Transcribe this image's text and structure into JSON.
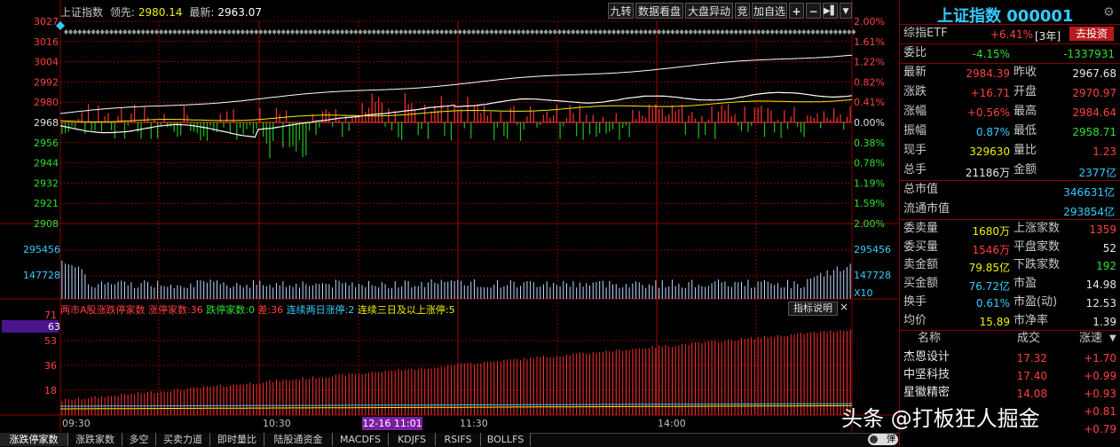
{
  "header": {
    "index_name": "上证指数",
    "lead_label": "领先:",
    "lead_value": "2980.14",
    "last_label": "最新:",
    "last_value": "2963.07"
  },
  "toolbar": {
    "buttons": [
      "九转",
      "数据看盘",
      "大盘异动",
      "竞",
      "加自选"
    ],
    "icon_buttons": [
      "plus-icon",
      "minus-icon",
      "play-icon",
      "dropdown-icon"
    ]
  },
  "price_axis_left": [
    "3027",
    "3016",
    "3004",
    "2992",
    "2980",
    "2968",
    "2956",
    "2944",
    "2932",
    "2921",
    "2908"
  ],
  "price_axis_right": [
    "2.00%",
    "1.61%",
    "1.22%",
    "0.82%",
    "0.41%",
    "0.00%",
    "0.38%",
    "0.78%",
    "1.19%",
    "1.59%",
    "2.00%"
  ],
  "volume_axis_left": [
    "295456",
    "147728"
  ],
  "volume_axis_right": [
    "295456",
    "147728",
    "X10"
  ],
  "sub_chart": {
    "title": "两市A股涨跌停家数",
    "limit_up_label": "涨停家数:",
    "limit_up_value": "36",
    "limit_down_label": "跌停家数:",
    "limit_down_value": "0",
    "diff_label": "差:",
    "diff_value": "36",
    "two_day_label": "连续两日涨停:",
    "two_day_value": "2",
    "three_day_label": "连续三日及以上涨停:",
    "three_day_value": "5",
    "indicator_button": "指标说明",
    "close": "×",
    "axis": [
      "71",
      "63",
      "53",
      "36",
      "18"
    ]
  },
  "time_axis": {
    "labels": [
      "09:30",
      "10:30",
      "11:30",
      "14:00"
    ],
    "flag": "12-16 11:01"
  },
  "bottom_tabs": [
    "涨跌停家数",
    "涨跌家数",
    "多空",
    "买卖力道",
    "即时量比",
    "陆股通资金",
    "MACDFS",
    "KDJFS",
    "RSIFS",
    "BOLLFS"
  ],
  "toggle_label": "弹",
  "watermark": "头条 @打板狂人掘金",
  "panel": {
    "title": "上证指数 000001",
    "etf_name": "综指ETF",
    "etf_change": "+6.41%",
    "etf_period": "[3年]",
    "etf_button": "去投资",
    "ratio_label": "委比",
    "ratio_pct": "-4.15%",
    "ratio_value": "-1337931",
    "quotes": [
      {
        "l1": "最新",
        "v1": "2984.39",
        "c1": "red",
        "l2": "昨收",
        "v2": "2967.68",
        "c2": "white"
      },
      {
        "l1": "涨跌",
        "v1": "+16.71",
        "c1": "red",
        "l2": "开盘",
        "v2": "2970.97",
        "c2": "red"
      },
      {
        "l1": "涨幅",
        "v1": "+0.56%",
        "c1": "red",
        "l2": "最高",
        "v2": "2984.64",
        "c2": "red"
      },
      {
        "l1": "振幅",
        "v1": "0.87%",
        "c1": "cyan",
        "l2": "最低",
        "v2": "2958.71",
        "c2": "green"
      },
      {
        "l1": "现手",
        "v1": "329630",
        "c1": "yellow",
        "l2": "量比",
        "v2": "1.23",
        "c2": "red"
      },
      {
        "l1": "总手",
        "v1": "21186万",
        "c1": "white",
        "l2": "金额",
        "v2": "2377亿",
        "c2": "cyan"
      }
    ],
    "mcap": [
      {
        "l": "总市值",
        "v": "346631亿"
      },
      {
        "l": "流通市值",
        "v": "293854亿"
      }
    ],
    "stats": [
      {
        "l1": "委卖量",
        "v1": "1680万",
        "c1": "yellow",
        "l2": "上涨家数",
        "v2": "1359",
        "c2": "red"
      },
      {
        "l1": "委买量",
        "v1": "1546万",
        "c1": "red",
        "l2": "平盘家数",
        "v2": "52",
        "c2": "white"
      },
      {
        "l1": "卖金额",
        "v1": "79.85亿",
        "c1": "yellow",
        "l2": "下跌家数",
        "v2": "192",
        "c2": "green"
      },
      {
        "l1": "买金额",
        "v1": "76.72亿",
        "c1": "cyan",
        "l2": "市盈",
        "v2": "14.98",
        "c2": "white"
      },
      {
        "l1": "换手",
        "v1": "0.61%",
        "c1": "cyan",
        "l2": "市盈(动)",
        "v2": "12.53",
        "c2": "white"
      },
      {
        "l1": "均价",
        "v1": "15.89",
        "c1": "yellow",
        "l2": "市净率",
        "v2": "1.39",
        "c2": "white"
      }
    ],
    "table_headers": [
      "名称",
      "成交",
      "涨速"
    ],
    "table_rows": [
      {
        "name": "杰恩设计",
        "price": "17.32",
        "speed": "+1.70"
      },
      {
        "name": "中坚科技",
        "price": "17.40",
        "speed": "+0.99"
      },
      {
        "name": "星徽精密",
        "price": "14.08",
        "speed": "+0.93"
      },
      {
        "name": "",
        "price": "",
        "speed": "+0.81"
      },
      {
        "name": "",
        "price": "",
        "speed": "+0.79"
      }
    ]
  },
  "colors": {
    "up": "#ff3030",
    "down": "#20c020",
    "grid": "#8b0000",
    "axis_text": "#c0c0c0",
    "price_line": "#ffffff",
    "avg_line": "#f0f000"
  }
}
